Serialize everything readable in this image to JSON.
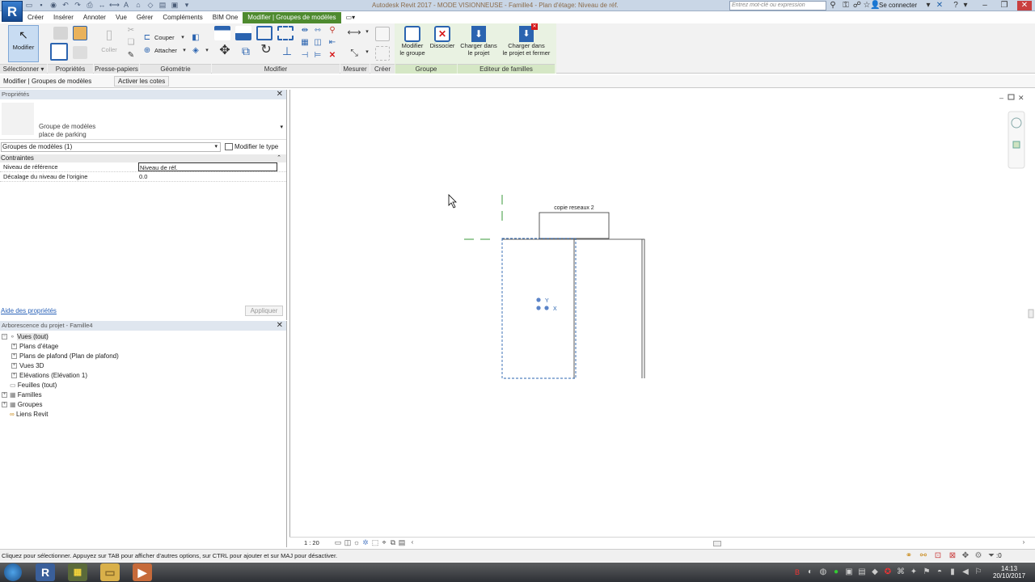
{
  "window": {
    "title": "Autodesk Revit 2017 - MODE VISIONNEUSE -   Famille4 - Plan d'étage: Niveau de réf.",
    "app_logo": "R"
  },
  "search": {
    "placeholder": "Entrez mot-clé ou expression"
  },
  "account": {
    "login": "Se connecter"
  },
  "tabs": [
    "Créer",
    "Insérer",
    "Annoter",
    "Vue",
    "Gérer",
    "Compléments",
    "BIM One",
    "Modifier | Groupes de modèles"
  ],
  "active_tab_index": 7,
  "ribbon": {
    "modify_label": "Modifier",
    "paste_label": "Coller",
    "cut_label": "Couper",
    "join_label": "Attacher",
    "edit_group_label": "Modifier\nle groupe",
    "ungroup_label": "Dissocier",
    "load_project_label": "Charger dans\nle projet",
    "load_close_label": "Charger dans\nle projet et fermer",
    "panels": [
      "Sélectionner",
      "Propriétés",
      "Presse-papiers",
      "Géométrie",
      "Modifier",
      "Mesurer",
      "Créer",
      "Groupe",
      "Editeur de familles"
    ]
  },
  "context_bar": {
    "label": "Modifier | Groupes de modèles",
    "button": "Activer les cotes"
  },
  "properties": {
    "title": "Propriétés",
    "type_line1": "Groupe de modèles",
    "type_line2": "place de parking",
    "instance_selector": "Groupes de modèles (1)",
    "edit_type": "Modifier le type",
    "group": "Contraintes",
    "rows": [
      {
        "label": "Niveau de référence",
        "value": "Niveau de réf."
      },
      {
        "label": "Décalage du niveau de l'origine",
        "value": "0.0"
      }
    ],
    "help_link": "Aide des propriétés",
    "apply": "Appliquer"
  },
  "browser": {
    "title": "Arborescence du projet - Famille4",
    "nodes": [
      {
        "label": "Vues (tout)",
        "indent": 0
      },
      {
        "label": "Plans d'étage",
        "indent": 1
      },
      {
        "label": "Plans de plafond (Plan de plafond)",
        "indent": 1
      },
      {
        "label": "Vues 3D",
        "indent": 1
      },
      {
        "label": "Elévations (Elévation 1)",
        "indent": 1
      },
      {
        "label": "Feuilles (tout)",
        "indent": 0
      },
      {
        "label": "Familles",
        "indent": 0
      },
      {
        "label": "Groupes",
        "indent": 0
      },
      {
        "label": "Liens Revit",
        "indent": 0
      }
    ]
  },
  "drawing": {
    "tag_label": "copie reseaux 2",
    "axis_y": "Y",
    "axis_x": "X"
  },
  "view_controls": {
    "scale": "1 : 20"
  },
  "status": {
    "text": "Cliquez pour sélectionner. Appuyez sur TAB pour afficher d'autres options, sur CTRL pour ajouter et sur MAJ pour désactiver.",
    "filter_count": ":0"
  },
  "taskbar": {
    "time": "14:13",
    "date": "20/10/2017"
  }
}
